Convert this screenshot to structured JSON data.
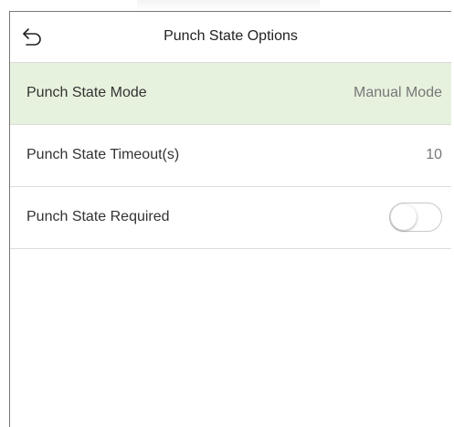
{
  "header": {
    "title": "Punch State Options",
    "back_icon": "back-arrow-icon"
  },
  "settings": [
    {
      "label": "Punch State Mode",
      "value": "Manual Mode",
      "selected": true
    },
    {
      "label": "Punch State Timeout(s)",
      "value": "10"
    },
    {
      "label": "Punch State Required",
      "toggle_on": false
    }
  ],
  "colors": {
    "selected_row": "#e7f2de",
    "divider": "#dcdcdc"
  }
}
